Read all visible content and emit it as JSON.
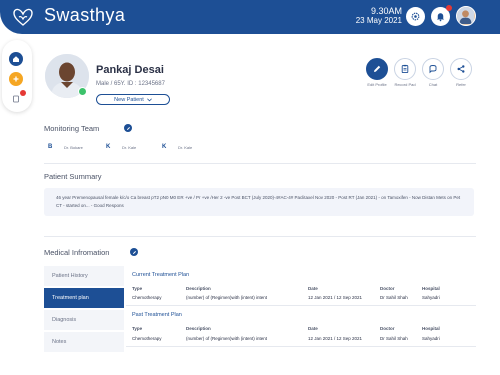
{
  "header": {
    "brand": "Swasthya",
    "time": "9.30AM",
    "date": "23 May 2021",
    "colors": {
      "primary": "#1d4f95",
      "alert": "#e53935",
      "accent": "#f5a623"
    }
  },
  "patient": {
    "name": "Pankaj Desai",
    "meta": "Male / 65Y.  ID : 12345687",
    "status_option": "New Patient"
  },
  "actions": [
    {
      "label": "Edit Profile",
      "icon": "pencil-icon"
    },
    {
      "label": "Record Pad",
      "icon": "clipboard-icon"
    },
    {
      "label": "Chat",
      "icon": "chat-icon"
    },
    {
      "label": "Refer",
      "icon": "share-icon"
    }
  ],
  "monitoring": {
    "title": "Monitoring Team",
    "members": [
      {
        "initial": "B",
        "name": "Dr. Bokare"
      },
      {
        "initial": "K",
        "name": "Dr. Kale"
      },
      {
        "initial": "K",
        "name": "Dr. Kale"
      }
    ]
  },
  "summary": {
    "title": "Patient Summary",
    "text": "46 year Premenopausal female k/c/o Ca breast pT2 pN0 M0 ER +ve / Pr +ve /Her 2 -ve Post BCT (July 2020)-4#AC-4# Paclitaxel Nov 2020 - Post RT (Jan 2021) - on Tamoxifen - Now Distan Mets on Pet CT - started on... - Good Respons"
  },
  "medical": {
    "title": "Medical Infromation",
    "tabs": [
      "Patient History",
      "Treatment plan",
      "Diagnosis",
      "Notes"
    ],
    "columns": [
      "Type",
      "Description",
      "Date",
      "Doctor",
      "Hospital"
    ],
    "current": {
      "title": "Current Treatment Plan",
      "row": [
        "Chemotherapy",
        "(number) of (Regimen)with (intent) intent",
        "12 Jan 2021 / 12 Sep 2021",
        "Dr Sahil Shah",
        "Sahyadri"
      ]
    },
    "past": {
      "title": "Past Treatment Plan",
      "row": [
        "Chemotherapy",
        "(number) of (Regimen)with (intent) intent",
        "12 Jan 2021 / 12 Sep 2021",
        "Dr Sahil Shah",
        "Sahyadri"
      ]
    }
  }
}
